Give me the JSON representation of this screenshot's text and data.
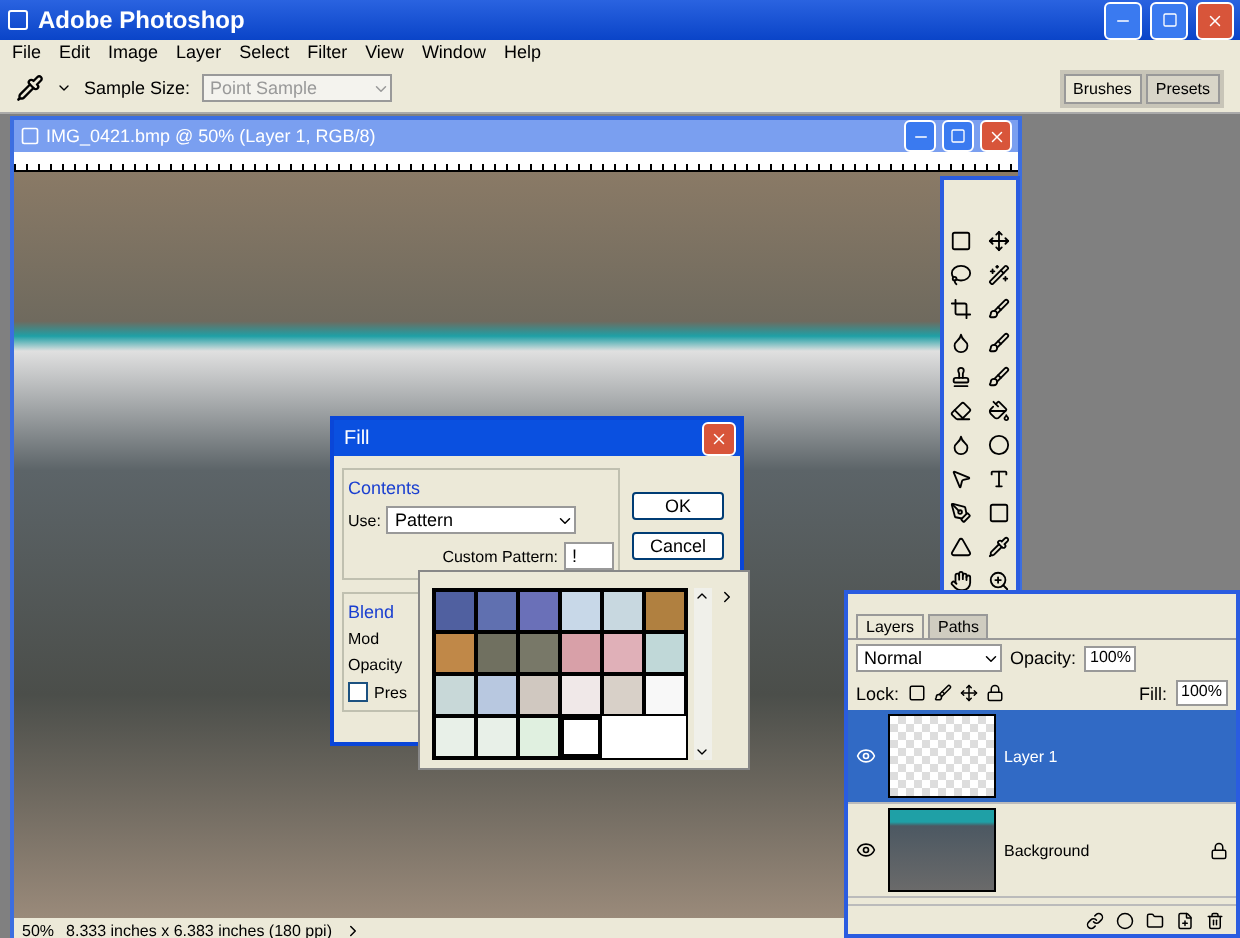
{
  "window": {
    "title": "Adobe Photoshop"
  },
  "menu": [
    "File",
    "Edit",
    "Image",
    "Layer",
    "Select",
    "Filter",
    "View",
    "Window",
    "Help"
  ],
  "options_bar": {
    "label": "Sample Size:",
    "value": "Point Sample",
    "palette_tabs": [
      {
        "label": "Brushes",
        "selected": true
      },
      {
        "label": "Presets",
        "selected": false
      }
    ]
  },
  "document": {
    "title": "IMG_0421.bmp @ 50% (Layer 1, RGB/8)",
    "zoom": "50%",
    "info": "8.333 inches x 6.383 inches (180 ppi)"
  },
  "fill_dialog": {
    "title": "Fill",
    "contents_label": "Contents",
    "use_label": "Use:",
    "use_value": "Pattern",
    "custom_label": "Custom Pattern:",
    "custom_value": "!",
    "blending_label": "Blend",
    "mode_label": "Mod",
    "opacity_label": "Opacity",
    "preserve_label": "Pres",
    "preserve_checked": false,
    "buttons": [
      "OK",
      "Cancel"
    ]
  },
  "pattern_picker": {
    "patterns": [
      {
        "selected": false
      },
      {
        "selected": false
      },
      {
        "selected": false
      },
      {
        "selected": false
      },
      {
        "selected": false
      },
      {
        "selected": false
      },
      {
        "selected": false
      },
      {
        "selected": false
      },
      {
        "selected": false
      },
      {
        "selected": false
      },
      {
        "selected": false
      },
      {
        "selected": false
      },
      {
        "selected": false
      },
      {
        "selected": false
      },
      {
        "selected": false
      },
      {
        "selected": false
      },
      {
        "selected": false
      },
      {
        "selected": false
      },
      {
        "selected": false
      },
      {
        "selected": false
      },
      {
        "selected": false
      },
      {
        "selected": true
      }
    ]
  },
  "layers_panel": {
    "tabs": [
      {
        "label": "Layers",
        "selected": true
      },
      {
        "label": "Paths",
        "selected": false
      }
    ],
    "blend_mode": "Normal",
    "opacity_label": "Opacity:",
    "opacity": "100%",
    "lock_label": "Lock:",
    "fill_label": "Fill:",
    "fill": "100%",
    "layers": [
      {
        "name": "Layer 1",
        "kind": "transparent",
        "selected": true,
        "visible": true,
        "locked": false
      },
      {
        "name": "Background",
        "kind": "photo",
        "selected": false,
        "visible": true,
        "locked": true
      }
    ]
  }
}
